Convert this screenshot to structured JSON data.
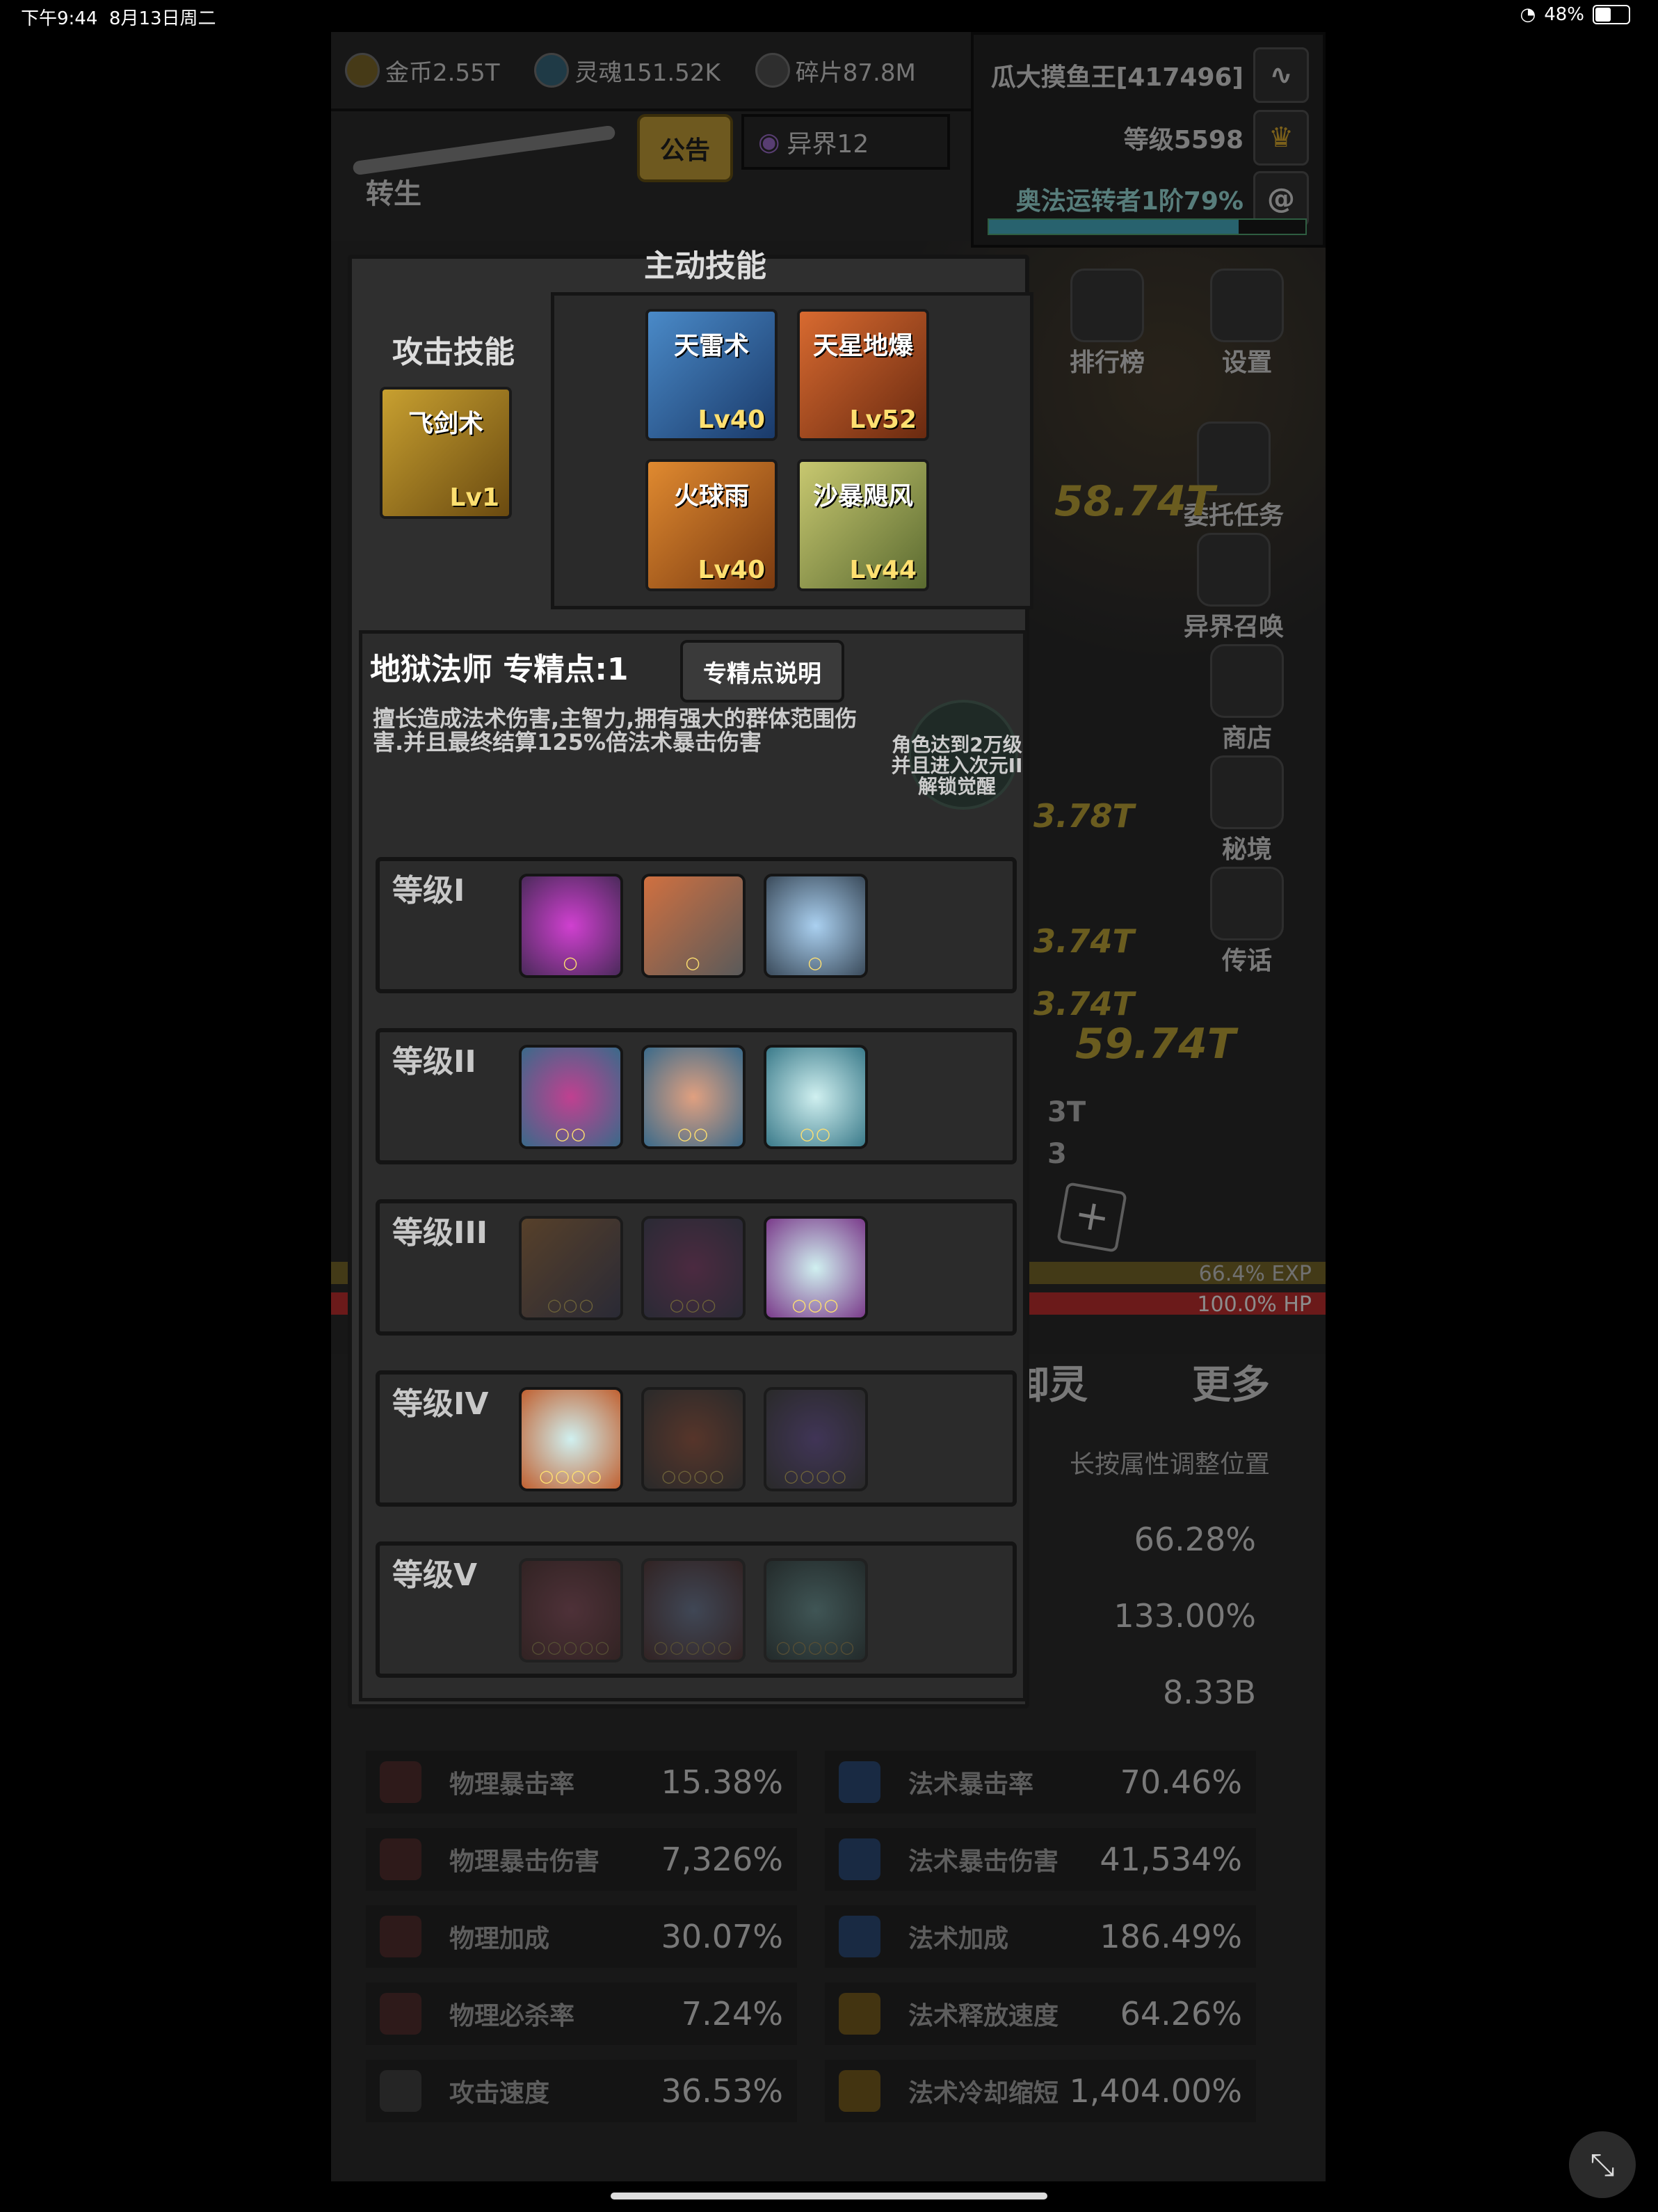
{
  "status_bar": {
    "time": "下午9:44",
    "date": "8月13日周二",
    "battery": "48%",
    "battery_level": 0.48
  },
  "resources": [
    {
      "icon": "gold-coin-icon",
      "label": "金币2.55T"
    },
    {
      "icon": "soul-icon",
      "label": "灵魂151.52K"
    },
    {
      "icon": "fragment-icon",
      "label": "碎片87.8M"
    }
  ],
  "player": {
    "name": "瓜大摸鱼王[417496]",
    "level": "等级5598",
    "rank": "奥法运转者1阶79%",
    "rank_progress": 0.79
  },
  "top_buttons": {
    "announcement": "公告",
    "other_world": "异界12",
    "rebirth": "转生"
  },
  "side_menu": [
    "排行榜",
    "设置",
    "委托任务",
    "异界召唤",
    "商店",
    "秘境",
    "传话"
  ],
  "damage_texts": [
    "58.74T",
    "3.78T",
    "3.74T",
    "3.74T",
    "59.74T",
    "3T",
    "3"
  ],
  "bars": {
    "exp": "66.4% EXP",
    "hp": "100.0% HP",
    "exp_level": 0.664,
    "hp_level": 1.0
  },
  "bottom_tabs": [
    "御灵",
    "更多"
  ],
  "hint": "长按属性调整位置",
  "top_right_stats": [
    "66.28%",
    "133.00%",
    "8.33B"
  ],
  "stats": [
    {
      "l_name": "物理暴击率",
      "l_val": "15.38%",
      "r_name": "法术暴击率",
      "r_val": "70.46%"
    },
    {
      "l_name": "物理暴击伤害",
      "l_val": "7,326%",
      "r_name": "法术暴击伤害",
      "r_val": "41,534%"
    },
    {
      "l_name": "物理加成",
      "l_val": "30.07%",
      "r_name": "法术加成",
      "r_val": "186.49%"
    },
    {
      "l_name": "物理必杀率",
      "l_val": "7.24%",
      "r_name": "法术释放速度",
      "r_val": "64.26%"
    },
    {
      "l_name": "攻击速度",
      "l_val": "36.53%",
      "r_name": "法术冷却缩短",
      "r_val": "1,404.00%"
    }
  ],
  "skills_panel": {
    "title": "主动技能",
    "attack_title": "攻击技能",
    "attack_skill": {
      "name": "飞剑术",
      "level": "Lv1"
    },
    "active_skills": [
      {
        "name": "天雷术",
        "level": "Lv40"
      },
      {
        "name": "天星地爆",
        "level": "Lv52"
      },
      {
        "name": "火球雨",
        "level": "Lv40"
      },
      {
        "name": "沙暴飓风",
        "level": "Lv44"
      }
    ]
  },
  "spec": {
    "title": "地狱法师 专精点:1",
    "button": "专精点说明",
    "description": "擅长造成法术伤害,主智力,拥有强大的群体范围伤害.并且最终结算125%倍法术暴击伤害",
    "awaken": "角色达到2万级并且进入次元II解锁觉醒",
    "tiers": [
      {
        "name": "等级I",
        "dots": "○",
        "locked": false
      },
      {
        "name": "等级II",
        "dots": "○○",
        "locked": false
      },
      {
        "name": "等级III",
        "dots": "○○○",
        "locked": false
      },
      {
        "name": "等级IV",
        "dots": "○○○○",
        "locked": false
      },
      {
        "name": "等级V",
        "dots": "○○○○○",
        "locked": true
      }
    ]
  },
  "colors": {
    "gold": "#c9a33a",
    "exp": "#7a6a2a",
    "hp": "#c43030",
    "panel": "#2f2f2f"
  }
}
